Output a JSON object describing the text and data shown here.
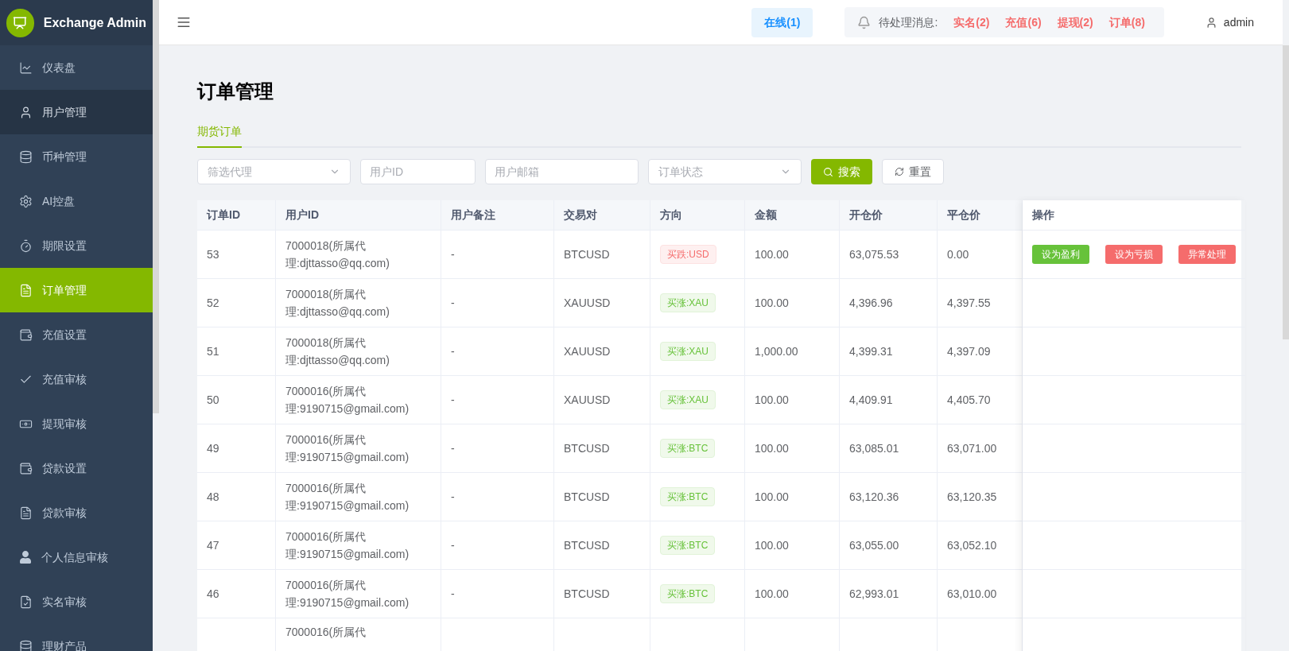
{
  "brand": {
    "title": "Exchange Admin"
  },
  "sidebar": {
    "items": [
      {
        "label": "仪表盘",
        "selected": false,
        "hovered": false
      },
      {
        "label": "用户管理",
        "selected": false,
        "hovered": true
      },
      {
        "label": "币种管理",
        "selected": false,
        "hovered": false
      },
      {
        "label": "AI控盘",
        "selected": false,
        "hovered": false
      },
      {
        "label": "期限设置",
        "selected": false,
        "hovered": false
      },
      {
        "label": "订单管理",
        "selected": true,
        "hovered": false
      },
      {
        "label": "充值设置",
        "selected": false,
        "hovered": false
      },
      {
        "label": "充值审核",
        "selected": false,
        "hovered": false
      },
      {
        "label": "提现审核",
        "selected": false,
        "hovered": false
      },
      {
        "label": "贷款设置",
        "selected": false,
        "hovered": false
      },
      {
        "label": "贷款审核",
        "selected": false,
        "hovered": false
      },
      {
        "label": "个人信息审核",
        "selected": false,
        "hovered": false
      },
      {
        "label": "实名审核",
        "selected": false,
        "hovered": false
      },
      {
        "label": "理财产品",
        "selected": false,
        "hovered": false
      }
    ]
  },
  "header": {
    "online": "在线(1)",
    "pending_label": "待处理消息:",
    "pending": [
      "实名(2)",
      "充值(6)",
      "提现(2)",
      "订单(8)"
    ],
    "user": "admin"
  },
  "page": {
    "title": "订单管理",
    "tabs": [
      {
        "label": "期货订单",
        "selected": true
      }
    ]
  },
  "filters": [
    {
      "kind": "select",
      "placeholder": "筛选代理"
    },
    {
      "kind": "input",
      "placeholder": "用户ID"
    },
    {
      "kind": "input",
      "placeholder": "用户邮箱"
    },
    {
      "kind": "select",
      "placeholder": "订单状态"
    }
  ],
  "buttons": [
    {
      "kind": "primary",
      "label": "搜索"
    },
    {
      "kind": "plain",
      "label": "重置"
    }
  ],
  "table": {
    "columns": [
      "订单ID",
      "用户ID",
      "用户备注",
      "交易对",
      "方向",
      "金额",
      "开仓价",
      "平仓价",
      "操作"
    ],
    "rows": [
      {
        "id": "53",
        "user": [
          "7000018(所属代",
          "理:djttasso@qq.com)"
        ],
        "note": "-",
        "pair": "BTCUSD",
        "direction": {
          "text": "买跌:USD",
          "kind": "down"
        },
        "amount": "100.00",
        "open": "63,075.53",
        "close": "0.00",
        "actions": [
          {
            "label": "设为盈利",
            "kind": "success"
          },
          {
            "label": "设为亏损",
            "kind": "danger"
          },
          {
            "label": "异常处理",
            "kind": "danger"
          }
        ]
      },
      {
        "id": "52",
        "user": [
          "7000018(所属代",
          "理:djttasso@qq.com)"
        ],
        "note": "-",
        "pair": "XAUUSD",
        "direction": {
          "text": "买涨:XAU",
          "kind": "up"
        },
        "amount": "100.00",
        "open": "4,396.96",
        "close": "4,397.55",
        "actions": []
      },
      {
        "id": "51",
        "user": [
          "7000018(所属代",
          "理:djttasso@qq.com)"
        ],
        "note": "-",
        "pair": "XAUUSD",
        "direction": {
          "text": "买涨:XAU",
          "kind": "up"
        },
        "amount": "1,000.00",
        "open": "4,399.31",
        "close": "4,397.09",
        "actions": []
      },
      {
        "id": "50",
        "user": [
          "7000016(所属代",
          "理:9190715@gmail.com)"
        ],
        "note": "-",
        "pair": "XAUUSD",
        "direction": {
          "text": "买涨:XAU",
          "kind": "up"
        },
        "amount": "100.00",
        "open": "4,409.91",
        "close": "4,405.70",
        "actions": []
      },
      {
        "id": "49",
        "user": [
          "7000016(所属代",
          "理:9190715@gmail.com)"
        ],
        "note": "-",
        "pair": "BTCUSD",
        "direction": {
          "text": "买涨:BTC",
          "kind": "up"
        },
        "amount": "100.00",
        "open": "63,085.01",
        "close": "63,071.00",
        "actions": []
      },
      {
        "id": "48",
        "user": [
          "7000016(所属代",
          "理:9190715@gmail.com)"
        ],
        "note": "-",
        "pair": "BTCUSD",
        "direction": {
          "text": "买涨:BTC",
          "kind": "up"
        },
        "amount": "100.00",
        "open": "63,120.36",
        "close": "63,120.35",
        "actions": []
      },
      {
        "id": "47",
        "user": [
          "7000016(所属代",
          "理:9190715@gmail.com)"
        ],
        "note": "-",
        "pair": "BTCUSD",
        "direction": {
          "text": "买涨:BTC",
          "kind": "up"
        },
        "amount": "100.00",
        "open": "63,055.00",
        "close": "63,052.10",
        "actions": []
      },
      {
        "id": "46",
        "user": [
          "7000016(所属代",
          "理:9190715@gmail.com)"
        ],
        "note": "-",
        "pair": "BTCUSD",
        "direction": {
          "text": "买涨:BTC",
          "kind": "up"
        },
        "amount": "100.00",
        "open": "62,993.01",
        "close": "63,010.00",
        "actions": []
      },
      {
        "user": [
          "7000016(所属代"
        ]
      }
    ]
  }
}
